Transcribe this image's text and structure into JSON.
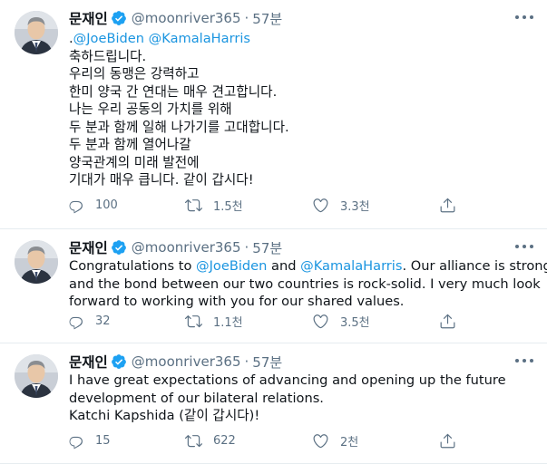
{
  "tweets": [
    {
      "author": "문재인",
      "handle": "@moonriver365",
      "separator": "·",
      "time": "57분",
      "lines": [
        [
          {
            "text": ".",
            "mention": false
          },
          {
            "text": "@JoeBiden",
            "mention": true
          },
          {
            "text": " ",
            "mention": false
          },
          {
            "text": "@KamalaHarris",
            "mention": true
          }
        ],
        [
          {
            "text": "축하드립니다.",
            "mention": false
          }
        ],
        [
          {
            "text": "우리의 동맹은 강력하고",
            "mention": false
          }
        ],
        [
          {
            "text": "한미 양국 간 연대는 매우 견고합니다.",
            "mention": false
          }
        ],
        [
          {
            "text": "나는 우리 공동의 가치를 위해",
            "mention": false
          }
        ],
        [
          {
            "text": "두 분과 함께 일해 나가기를 고대합니다.",
            "mention": false
          }
        ],
        [
          {
            "text": "두 분과 함께 열어나갈",
            "mention": false
          }
        ],
        [
          {
            "text": "양국관계의 미래 발전에",
            "mention": false
          }
        ],
        [
          {
            "text": "기대가 매우 큽니다. 같이 갑시다!",
            "mention": false
          }
        ]
      ],
      "replies": "100",
      "retweets": "1.5천",
      "likes": "3.3천"
    },
    {
      "author": "문재인",
      "handle": "@moonriver365",
      "separator": "·",
      "time": "57분",
      "lines": [
        [
          {
            "text": "Congratulations to ",
            "mention": false
          },
          {
            "text": "@JoeBiden",
            "mention": true
          },
          {
            "text": " and ",
            "mention": false
          },
          {
            "text": "@KamalaHarris",
            "mention": true
          },
          {
            "text": ". Our alliance is strong",
            "mention": false
          }
        ],
        [
          {
            "text": "and the bond between our two countries is rock-solid. I very much look",
            "mention": false
          }
        ],
        [
          {
            "text": "forward to working with you for our shared values.",
            "mention": false
          }
        ]
      ],
      "replies": "32",
      "retweets": "1.1천",
      "likes": "3.5천"
    },
    {
      "author": "문재인",
      "handle": "@moonriver365",
      "separator": "·",
      "time": "57분",
      "lines": [
        [
          {
            "text": "I have great expectations of advancing and opening up the future",
            "mention": false
          }
        ],
        [
          {
            "text": "development of our bilateral relations.",
            "mention": false
          }
        ],
        [
          {
            "text": "Katchi Kapshida (같이 갑시다)!",
            "mention": false
          }
        ]
      ],
      "replies": "15",
      "retweets": "622",
      "likes": "2천"
    }
  ],
  "icons": {
    "verified": "verified-badge-icon",
    "more": "more-options-icon",
    "reply": "reply-icon",
    "retweet": "retweet-icon",
    "like": "like-icon",
    "share": "share-icon"
  },
  "colors": {
    "accent": "#1da1f2",
    "mention": "#1b95e0",
    "secondary_text": "#5b7083",
    "divider": "#e6ecf0"
  }
}
